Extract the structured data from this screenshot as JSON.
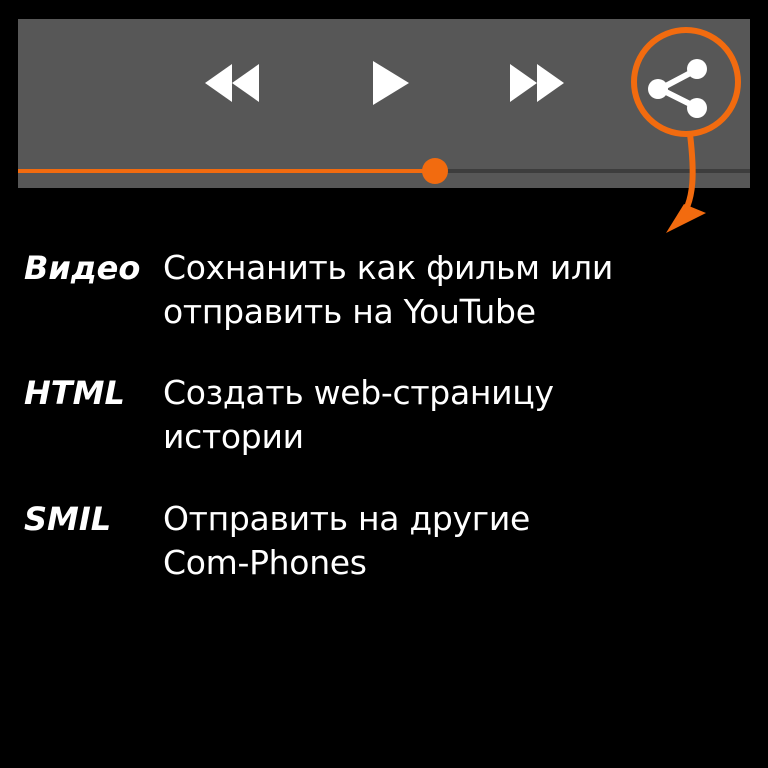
{
  "player": {
    "controls": {
      "rewind": "rewind-icon",
      "play": "play-icon",
      "forward": "fast-forward-icon",
      "share": "share-icon"
    },
    "progress": 0.57,
    "accent_color": "#f26b0f",
    "bar_color": "#575757"
  },
  "options": [
    {
      "key": "Видео",
      "line1": "Сохнанить как фильм или",
      "line2": "отправить на YouTube"
    },
    {
      "key": "HTML",
      "line1": "Создать web-страницу",
      "line2": "истории"
    },
    {
      "key": "SMIL",
      "line1": "Отправить на другие",
      "line2": "Com-Phones"
    }
  ]
}
